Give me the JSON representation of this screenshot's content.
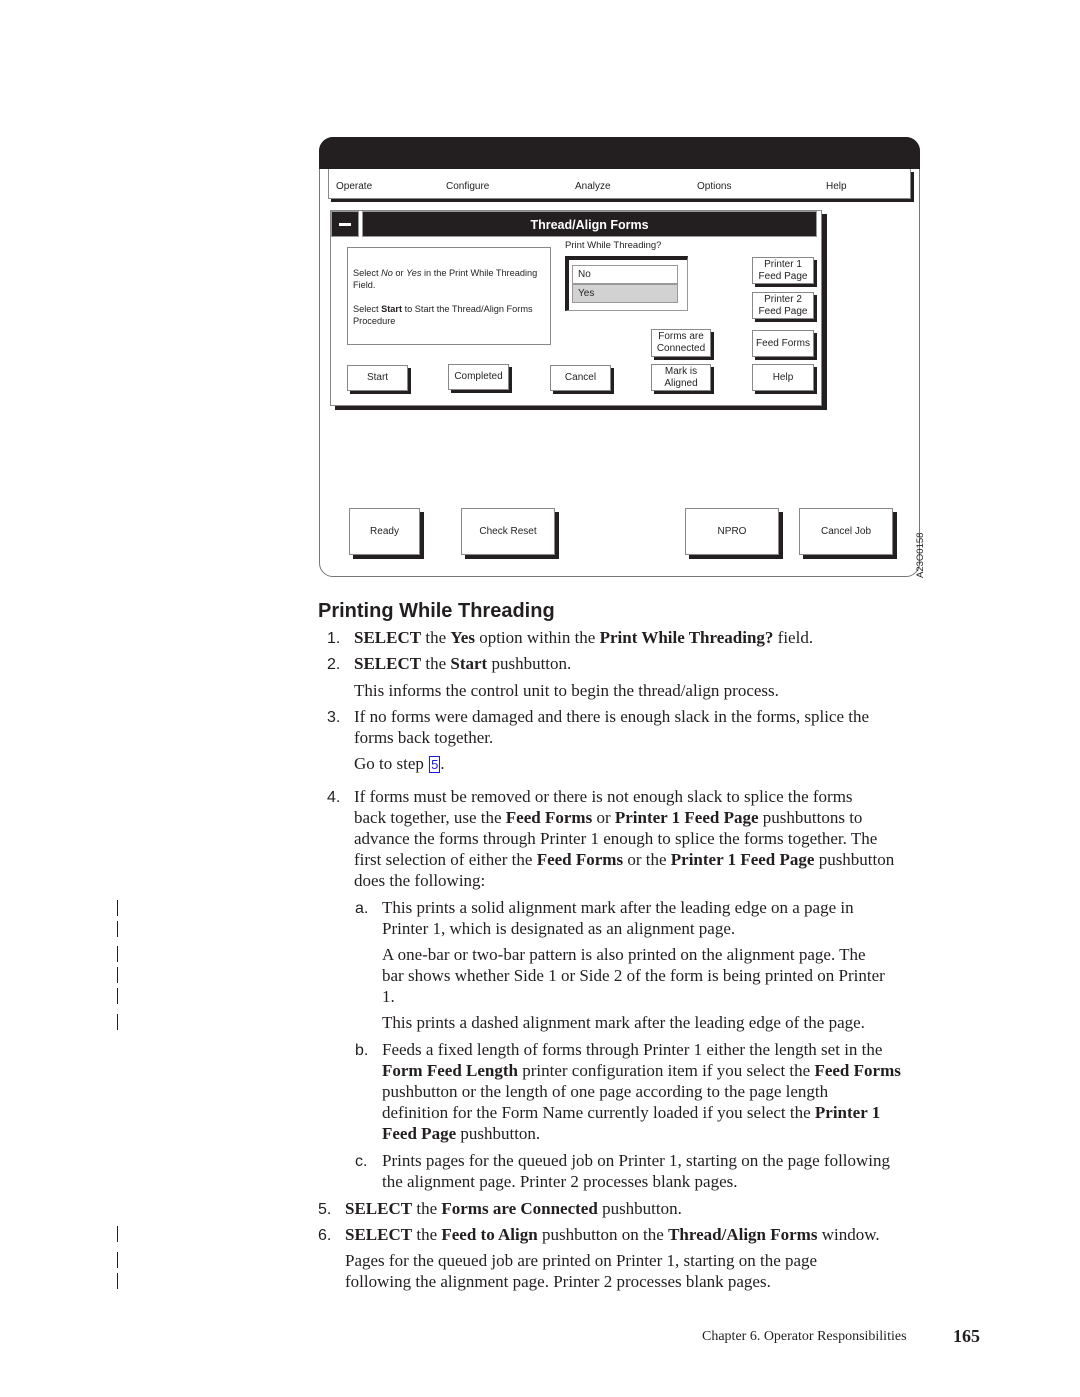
{
  "figure": {
    "menu": [
      "Operate",
      "Configure",
      "Analyze",
      "Options",
      "Help"
    ],
    "dialog": {
      "title": "Thread/Align Forms",
      "system_menu_icon": "minus-icon",
      "instructions": {
        "line1_pre": "Select ",
        "line1_no": "No",
        "line1_mid": " or ",
        "line1_yes": "Yes",
        "line1_post": " in the Print While Threading Field.",
        "line2_pre": "Select ",
        "line2_bold": "Start",
        "line2_post": " to Start the Thread/Align Forms Procedure"
      },
      "print_while_threading": {
        "label": "Print While Threading?",
        "options": [
          "No",
          "Yes"
        ],
        "selected": "Yes"
      },
      "buttons": {
        "start": "Start",
        "completed": "Completed",
        "cancel": "Cancel",
        "forms_connected_1": "Forms are",
        "forms_connected_2": "Connected",
        "mark_aligned_1": "Mark is",
        "mark_aligned_2": "Aligned",
        "printer1_1": "Printer 1",
        "printer1_2": "Feed Page",
        "printer2_1": "Printer 2",
        "printer2_2": "Feed Page",
        "feed_forms": "Feed Forms",
        "help": "Help"
      }
    },
    "bottom_buttons": [
      "Ready",
      "Check Reset",
      "NPRO",
      "Cancel Job"
    ],
    "figure_id": "A23O0158"
  },
  "section": {
    "heading": "Printing While Threading",
    "steps": {
      "s1": {
        "num": "1.",
        "a": "SELECT",
        "b": " the ",
        "c": "Yes",
        "d": " option within the ",
        "e": "Print While Threading?",
        "f": " field."
      },
      "s2": {
        "num": "2.",
        "a": "SELECT",
        "b": " the ",
        "c": "Start",
        "d": " pushbutton."
      },
      "s2_note": "This informs the control unit to begin the thread/align process.",
      "s3": {
        "num": "3.",
        "line1": "If no forms were damaged and there is enough slack in the forms, splice the",
        "line2": "forms back together."
      },
      "s3_goto": {
        "text": "Go to step ",
        "link": "5",
        "end": "."
      },
      "s4": {
        "num": "4.",
        "l1": "If forms must be removed or there is not enough slack to splice the forms",
        "l2a": "back together, use the ",
        "l2b": "Feed Forms",
        "l2c": " or ",
        "l2d": "Printer 1 Feed Page",
        "l2e": " pushbuttons to",
        "l3": "advance the forms through Printer 1 enough to splice the forms together. The",
        "l4a": "first selection of either the ",
        "l4b": "Feed Forms",
        "l4c": " or the ",
        "l4d": "Printer 1 Feed Page",
        "l4e": " pushbutton",
        "l5": "does the following:"
      },
      "s4a": {
        "num": "a.",
        "l1": "This prints a solid alignment mark after the leading edge on a page in",
        "l2": "Printer 1, which is designated as an alignment page."
      },
      "s4a_p2": {
        "l1": "A one-bar or two-bar pattern is also printed on the alignment page. The",
        "l2": "bar shows whether Side 1 or Side 2 of the form is being printed on Printer",
        "l3": "1."
      },
      "s4a_p3": "This prints a dashed alignment mark after the leading edge of the page.",
      "s4b": {
        "num": "b.",
        "l1": "Feeds a fixed length of forms through Printer 1 either the length set in the",
        "l2a": "Form Feed Length",
        "l2b": " printer configuration item if you select the ",
        "l2c": "Feed Forms",
        "l3": "pushbutton or the length of one page according to the page length",
        "l4a": "definition for the Form Name currently loaded if you select the ",
        "l4b": "Printer 1",
        "l5a": "Feed Page",
        "l5b": " pushbutton."
      },
      "s4c": {
        "num": "c.",
        "l1": "Prints pages for the queued job on Printer 1, starting on the page following",
        "l2": "the alignment page. Printer 2 processes blank pages."
      },
      "s5": {
        "num": "5.",
        "a": "SELECT",
        "b": " the ",
        "c": "Forms are Connected",
        "d": " pushbutton."
      },
      "s6": {
        "num": "6.",
        "a": "SELECT",
        "b": " the ",
        "c": "Feed to Align",
        "d": " pushbutton on the ",
        "e": "Thread/Align Forms",
        "f": " window."
      },
      "s6_note": {
        "l1": "Pages for the queued job are printed on Printer 1, starting on the page",
        "l2": "following the alignment page. Printer 2 processes blank pages."
      }
    }
  },
  "footer": {
    "chapter": "Chapter 6. Operator Responsibilities",
    "page": "165"
  }
}
